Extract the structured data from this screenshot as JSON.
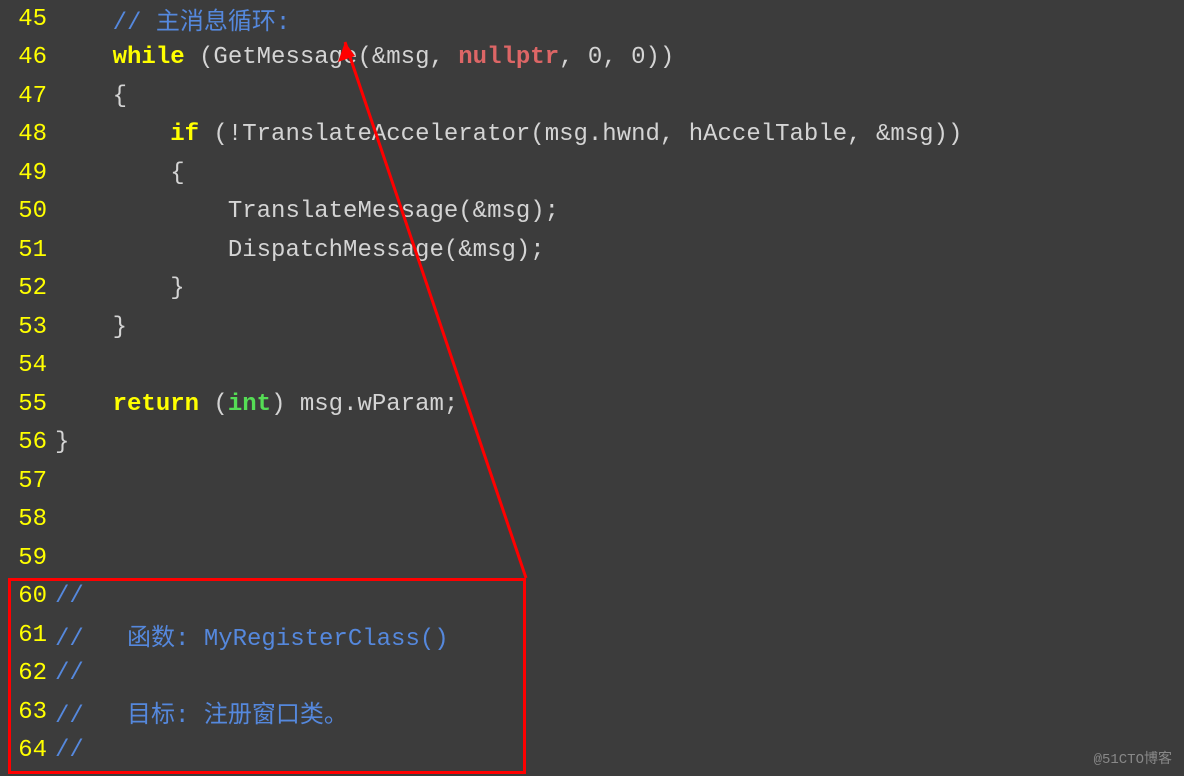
{
  "watermark": "@51CTO博客",
  "lines": [
    {
      "num": "45",
      "tokens": [
        {
          "text": "    ",
          "cls": ""
        },
        {
          "text": "// 主消息循环:",
          "cls": "comment"
        }
      ]
    },
    {
      "num": "46",
      "tokens": [
        {
          "text": "    ",
          "cls": ""
        },
        {
          "text": "while",
          "cls": "keyword"
        },
        {
          "text": " (GetMessage(&msg, ",
          "cls": ""
        },
        {
          "text": "nullptr",
          "cls": "nullptr"
        },
        {
          "text": ", 0, 0))",
          "cls": ""
        }
      ]
    },
    {
      "num": "47",
      "tokens": [
        {
          "text": "    {",
          "cls": ""
        }
      ]
    },
    {
      "num": "48",
      "tokens": [
        {
          "text": "        ",
          "cls": ""
        },
        {
          "text": "if",
          "cls": "keyword"
        },
        {
          "text": " (!TranslateAccelerator(msg.hwnd, hAccelTable, &msg))",
          "cls": ""
        }
      ]
    },
    {
      "num": "49",
      "tokens": [
        {
          "text": "        {",
          "cls": ""
        }
      ]
    },
    {
      "num": "50",
      "tokens": [
        {
          "text": "            TranslateMessage(&msg);",
          "cls": ""
        }
      ]
    },
    {
      "num": "51",
      "tokens": [
        {
          "text": "            DispatchMessage(&msg);",
          "cls": ""
        }
      ]
    },
    {
      "num": "52",
      "tokens": [
        {
          "text": "        }",
          "cls": ""
        }
      ]
    },
    {
      "num": "53",
      "tokens": [
        {
          "text": "    }",
          "cls": ""
        }
      ]
    },
    {
      "num": "54",
      "tokens": []
    },
    {
      "num": "55",
      "tokens": [
        {
          "text": "    ",
          "cls": ""
        },
        {
          "text": "return",
          "cls": "keyword"
        },
        {
          "text": " (",
          "cls": ""
        },
        {
          "text": "int",
          "cls": "type"
        },
        {
          "text": ") msg.wParam;",
          "cls": ""
        }
      ]
    },
    {
      "num": "56",
      "tokens": [
        {
          "text": "}",
          "cls": ""
        }
      ]
    },
    {
      "num": "57",
      "tokens": []
    },
    {
      "num": "58",
      "tokens": []
    },
    {
      "num": "59",
      "tokens": []
    },
    {
      "num": "60",
      "tokens": [
        {
          "text": "//",
          "cls": "comment"
        }
      ]
    },
    {
      "num": "61",
      "tokens": [
        {
          "text": "//   函数: MyRegisterClass()",
          "cls": "comment"
        }
      ]
    },
    {
      "num": "62",
      "tokens": [
        {
          "text": "//",
          "cls": "comment"
        }
      ]
    },
    {
      "num": "63",
      "tokens": [
        {
          "text": "//   目标: 注册窗口类。",
          "cls": "comment"
        }
      ]
    },
    {
      "num": "64",
      "tokens": [
        {
          "text": "//",
          "cls": "comment"
        }
      ]
    }
  ]
}
